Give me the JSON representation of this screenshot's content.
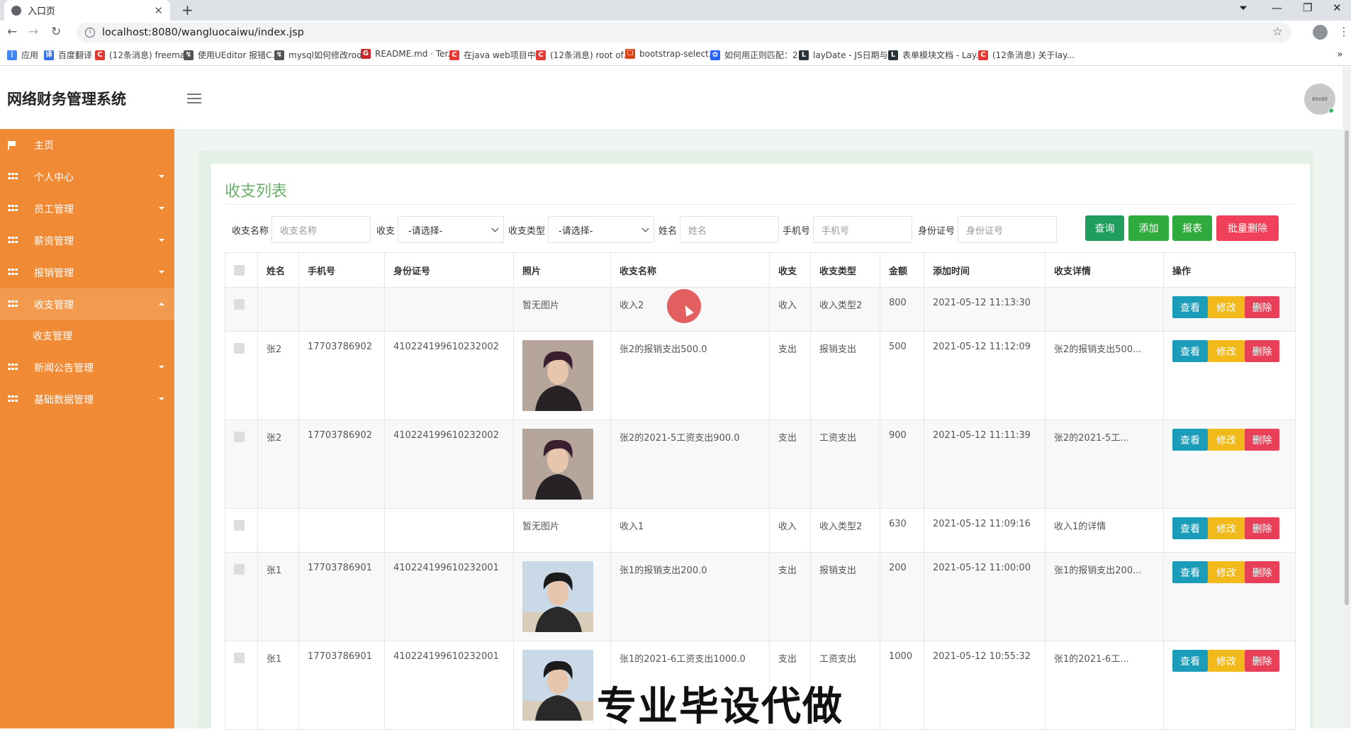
{
  "browser": {
    "tab_title": "入口页",
    "url": "localhost:8080/wangluocaiwu/index.jsp",
    "bookmarks": [
      {
        "label": "应用",
        "color": "#4285f4",
        "glyph": "⋮"
      },
      {
        "label": "百度翻译",
        "color": "#2f6fe4",
        "glyph": "译"
      },
      {
        "label": "(12条消息) freema...",
        "color": "#e53935",
        "glyph": "C"
      },
      {
        "label": "使用UEditor 报错C...",
        "color": "#555555",
        "glyph": "↯"
      },
      {
        "label": "mysql如何修改roo...",
        "color": "#555555",
        "glyph": "↯"
      },
      {
        "label": "README.md · Ter...",
        "color": "#c62828",
        "glyph": "G"
      },
      {
        "label": "在java web项目中...",
        "color": "#e53935",
        "glyph": "C"
      },
      {
        "label": "(12条消息) root of...",
        "color": "#e53935",
        "glyph": "C"
      },
      {
        "label": "bootstrap-select...",
        "color": "#d84315",
        "glyph": "☐"
      },
      {
        "label": "如何用正则匹配：2...",
        "color": "#2962ff",
        "glyph": "✿"
      },
      {
        "label": "layDate - JS日期与...",
        "color": "#263238",
        "glyph": "L"
      },
      {
        "label": "表单模块文档 - Lay...",
        "color": "#263238",
        "glyph": "L"
      },
      {
        "label": "(12条消息) 关于lay...",
        "color": "#e53935",
        "glyph": "C"
      }
    ]
  },
  "header": {
    "brand": "网络财务管理系统",
    "avatar_text": "80x80"
  },
  "sidebar": {
    "items": [
      {
        "label": "主页",
        "icon": "flag-icon"
      },
      {
        "label": "个人中心",
        "icon": "grid-icon"
      },
      {
        "label": "员工管理",
        "icon": "grid-icon"
      },
      {
        "label": "薪资管理",
        "icon": "grid-icon"
      },
      {
        "label": "报销管理",
        "icon": "grid-icon"
      },
      {
        "label": "收支管理",
        "icon": "grid-icon"
      },
      {
        "label": "新闻公告管理",
        "icon": "grid-icon"
      },
      {
        "label": "基础数据管理",
        "icon": "grid-icon"
      }
    ],
    "sub_item": "收支管理"
  },
  "page": {
    "title": "收支列表"
  },
  "search": {
    "name_label": "收支名称",
    "name_placeholder": "收支名称",
    "type_label": "收支",
    "type_value": "-请选择-",
    "category_label": "收支类型",
    "category_value": "-请选择-",
    "person_label": "姓名",
    "person_placeholder": "姓名",
    "phone_label": "手机号",
    "phone_placeholder": "手机号",
    "id_label": "身份证号",
    "id_placeholder": "身份证号"
  },
  "buttons": {
    "query": "查询",
    "add": "添加",
    "report": "报表",
    "batch_delete": "批量删除",
    "colors": {
      "query": "#1f9d5c",
      "add": "#2eab3c",
      "report": "#2eab3c",
      "batch_delete": "#f0405a"
    }
  },
  "table": {
    "headers": [
      "姓名",
      "手机号",
      "身份证号",
      "照片",
      "收支名称",
      "收支",
      "收支类型",
      "金额",
      "添加时间",
      "收支详情",
      "操作"
    ],
    "rows": [
      {
        "name": "",
        "phone": "",
        "idcard": "",
        "photo": "暂无图片",
        "title": "收入2",
        "kind": "收入",
        "category": "收入类型2",
        "amount": "800",
        "time": "2021-05-12 11:13:30",
        "detail": ""
      },
      {
        "name": "张2",
        "phone": "17703786902",
        "idcard": "410224199610232002",
        "photo": "",
        "title": "张2的报销支出500.0",
        "kind": "支出",
        "category": "报销支出",
        "amount": "500",
        "time": "2021-05-12 11:12:09",
        "detail": "张2的报销支出500..."
      },
      {
        "name": "张2",
        "phone": "17703786902",
        "idcard": "410224199610232002",
        "photo": "",
        "title": "张2的2021-5工资支出900.0",
        "kind": "支出",
        "category": "工资支出",
        "amount": "900",
        "time": "2021-05-12 11:11:39",
        "detail": "张2的2021-5工..."
      },
      {
        "name": "",
        "phone": "",
        "idcard": "",
        "photo": "暂无图片",
        "title": "收入1",
        "kind": "收入",
        "category": "收入类型2",
        "amount": "630",
        "time": "2021-05-12 11:09:16",
        "detail": "收入1的详情"
      },
      {
        "name": "张1",
        "phone": "17703786901",
        "idcard": "410224199610232001",
        "photo": "",
        "title": "张1的报销支出200.0",
        "kind": "支出",
        "category": "报销支出",
        "amount": "200",
        "time": "2021-05-12 11:00:00",
        "detail": "张1的报销支出200..."
      },
      {
        "name": "张1",
        "phone": "17703786901",
        "idcard": "410224199610232001",
        "photo": "",
        "title": "张1的2021-6工资支出1000.0",
        "kind": "支出",
        "category": "工资支出",
        "amount": "1000",
        "time": "2021-05-12 10:55:32",
        "detail": "张1的2021-6工..."
      }
    ],
    "ops": {
      "view": "查看",
      "edit": "修改",
      "delete": "删除"
    }
  },
  "overlay": {
    "watermark": "专业毕设代做"
  }
}
